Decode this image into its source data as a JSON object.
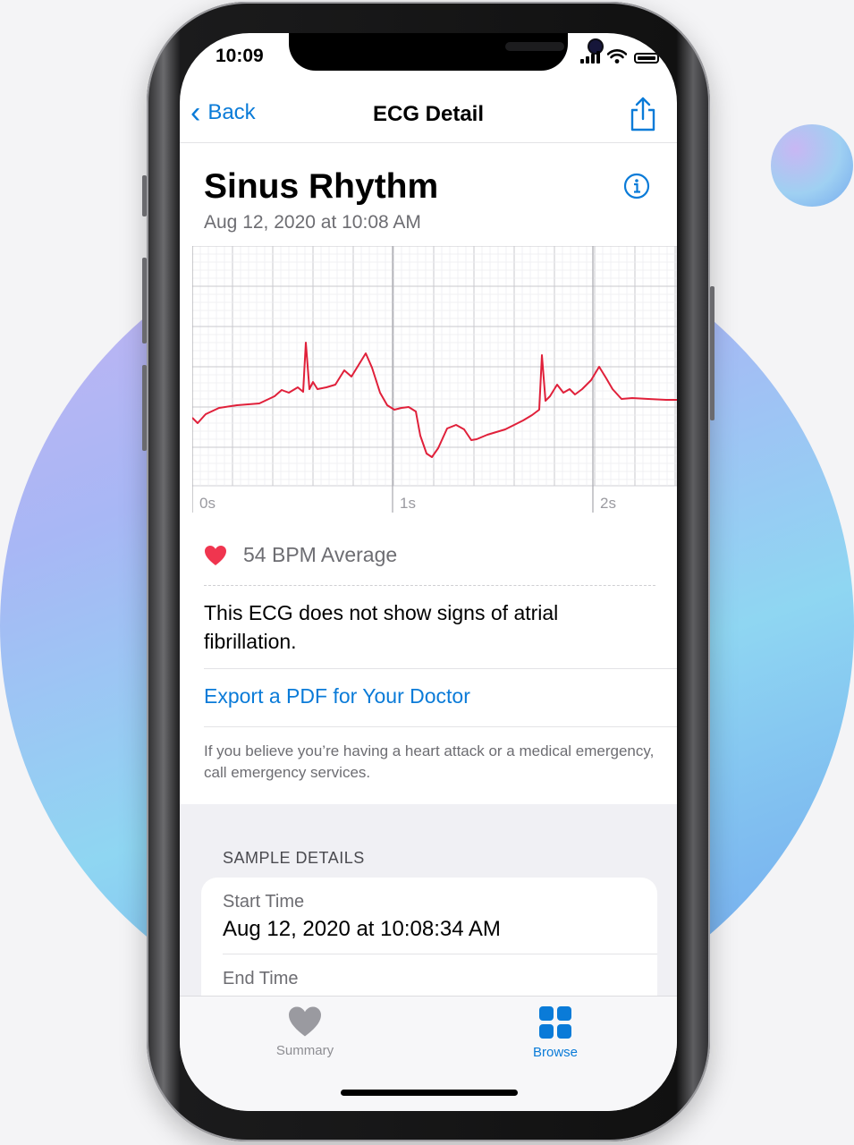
{
  "status_bar": {
    "time": "10:09"
  },
  "nav": {
    "back_label": "Back",
    "title": "ECG Detail"
  },
  "header": {
    "title": "Sinus Rhythm",
    "date": "Aug 12, 2020 at 10:08 AM"
  },
  "ecg": {
    "time_labels": [
      "0s",
      "1s",
      "2s"
    ],
    "line_color": "#e0203a"
  },
  "summary": {
    "bpm": "54 BPM Average",
    "description": "This ECG does not show signs of atrial fibrillation.",
    "export_link": "Export a PDF for Your Doctor",
    "warning": "If you believe you’re having a heart attack or a medical emergency, call emergency services."
  },
  "sample_details": {
    "header": "SAMPLE DETAILS",
    "rows": [
      {
        "label": "Start Time",
        "value": "Aug 12, 2020 at 10:08:34 AM"
      },
      {
        "label": "End Time"
      }
    ]
  },
  "tabbar": {
    "items": [
      {
        "label": "Summary",
        "icon": "heart-icon",
        "active": false
      },
      {
        "label": "Browse",
        "icon": "grid-icon",
        "active": true
      }
    ]
  },
  "colors": {
    "accent": "#0a7bd8",
    "heart": "#f0354f",
    "ecg_line": "#e0203a"
  }
}
